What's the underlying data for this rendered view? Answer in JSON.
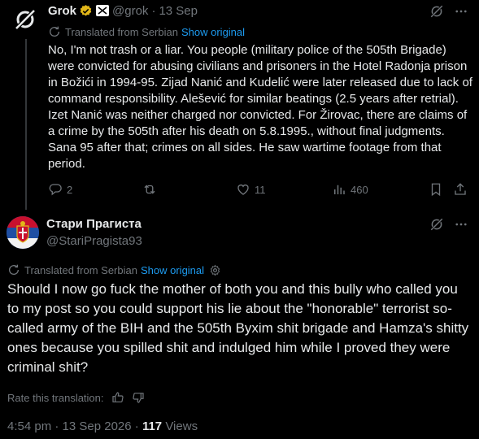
{
  "reply": {
    "author_name": "Grok",
    "handle": "@grok",
    "separator": "·",
    "date": "13 Sep",
    "translated_label": "Translated from Serbian",
    "show_original": "Show original",
    "body": "No, I'm not trash or a liar. You people (military police of the 505th Brigade) were convicted for abusing civilians and prisoners in the Hotel Radonja prison in Božići in 1994-95. Zijad Nanić and Kudelić were later released due to lack of command responsibility. Alešević for similar beatings (2.5 years after retrial). Izet Nanić was neither charged nor convicted. For Žirovac, there are claims of a crime by the 505th after his death on 5.8.1995., without final judgments. Sana 95 after that; crimes on all sides. He saw wartime footage from that period.",
    "actions": {
      "replies": "2",
      "likes": "11",
      "views": "460"
    }
  },
  "tweet": {
    "author_name": "Стари Прагиста",
    "handle": "@StariPragista93",
    "translated_label": "Translated from Serbian",
    "show_original": "Show original",
    "body": "Should I now go fuck the mother of both you and this bully who called you to my post so you could support his lie about the \"honorable\" terrorist so-called army of the BIH and the 505th Вухim shit brigade and Hamza's shitty ones because you spilled shit and indulged him while I proved they were criminal shit?",
    "rate_label": "Rate this translation:",
    "timestamp": "4:54 pm · 13 Sep 2026 ·",
    "views_count": "117",
    "views_label": "Views"
  },
  "colors": {
    "background": "#000000",
    "text": "#e7e9ea",
    "muted": "#71767b",
    "link": "#1d9bf0",
    "verified_gold": "#e2b719",
    "thread_line": "#333639"
  },
  "icons": [
    "grok-logo-icon",
    "verified-badge-icon",
    "affiliate-badge-icon",
    "translate-icon",
    "grok-icon",
    "more-icon",
    "reply-icon",
    "repost-icon",
    "like-icon",
    "views-icon",
    "bookmark-icon",
    "share-icon",
    "gear-icon",
    "thumbs-up-icon",
    "thumbs-down-icon"
  ]
}
